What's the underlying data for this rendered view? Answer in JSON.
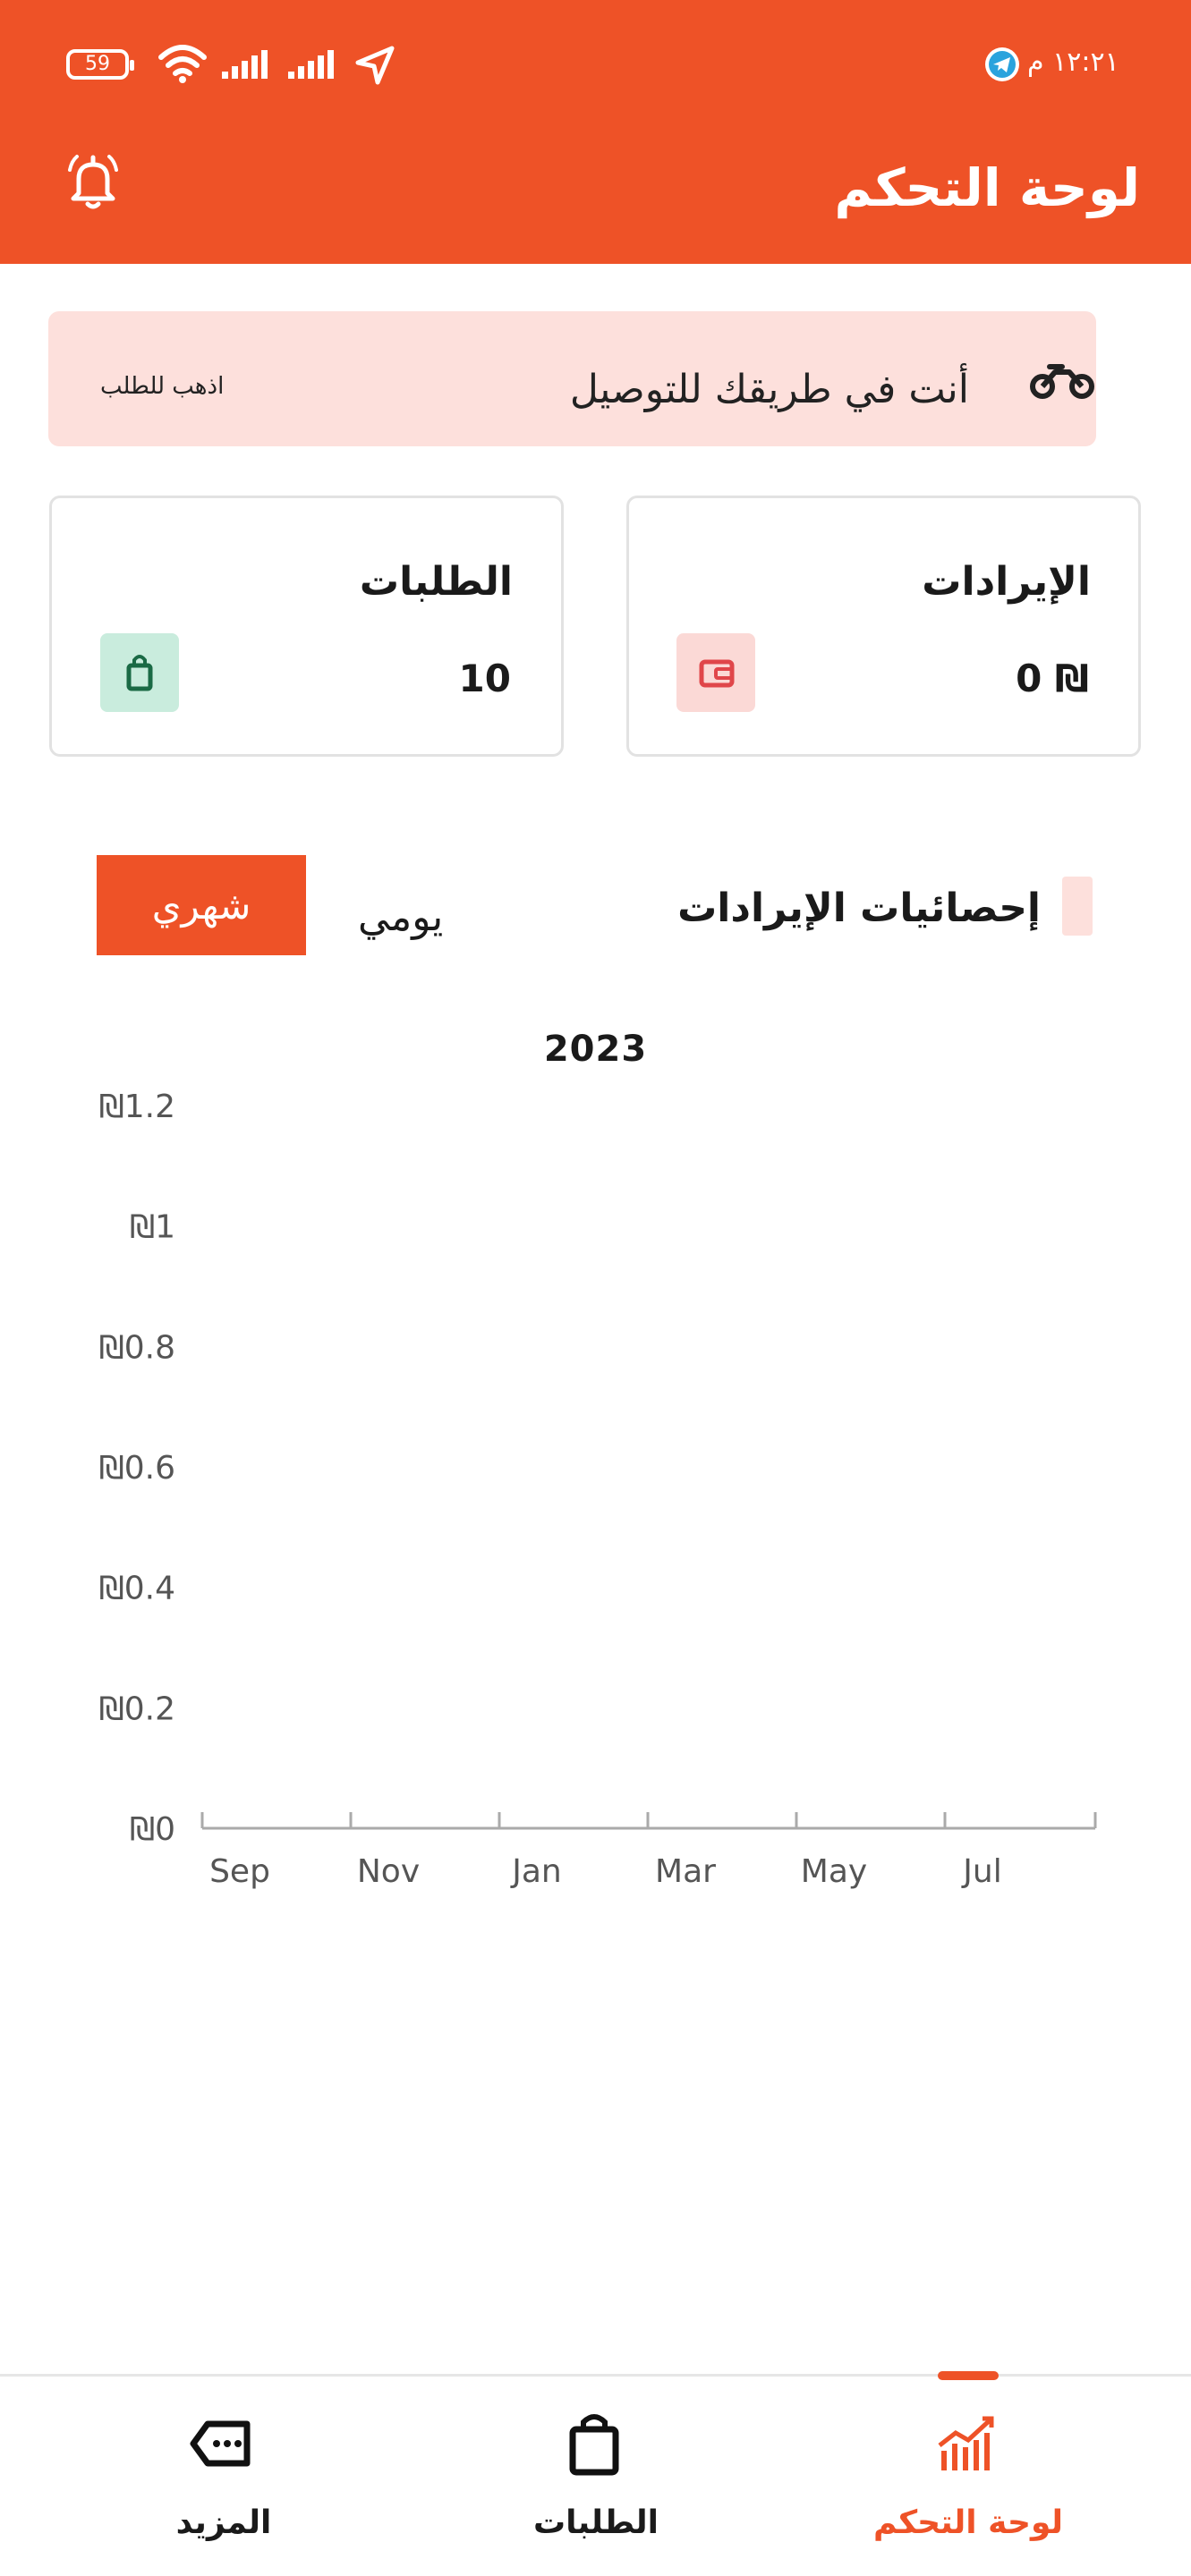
{
  "status_bar": {
    "time": "١٢:٢١ م",
    "battery": "59"
  },
  "header": {
    "title": "لوحة التحكم"
  },
  "delivery_banner": {
    "text": "أنت في طريقك للتوصيل",
    "action": "اذهب للطلب"
  },
  "cards": {
    "revenue": {
      "title": "الإيرادات",
      "value": "₪ 0"
    },
    "orders": {
      "title": "الطلبات",
      "value": "10"
    }
  },
  "stats": {
    "title": "إحصائيات الإيرادات",
    "daily_label": "يومي",
    "monthly_label": "شهري"
  },
  "chart_data": {
    "type": "bar",
    "title": "2023",
    "categories": [
      "Sep",
      "Nov",
      "Jan",
      "Mar",
      "May",
      "Jul"
    ],
    "values": [
      0,
      0,
      0,
      0,
      0,
      0
    ],
    "y_ticks": [
      "₪0",
      "₪0.2",
      "₪0.4",
      "₪0.6",
      "₪0.8",
      "₪1",
      "₪1.2"
    ],
    "ylim": [
      0,
      1.2
    ],
    "grid": false,
    "colors": {
      "bar": "#fde0dc"
    }
  },
  "bottom_nav": {
    "dashboard": "لوحة التحكم",
    "orders": "الطلبات",
    "more": "المزيد"
  },
  "colors": {
    "accent": "#ee5227",
    "banner_bg": "#fde0dc",
    "orders_icon_bg": "#c9ecdd",
    "revenue_icon_bg": "#fbd9d6"
  }
}
